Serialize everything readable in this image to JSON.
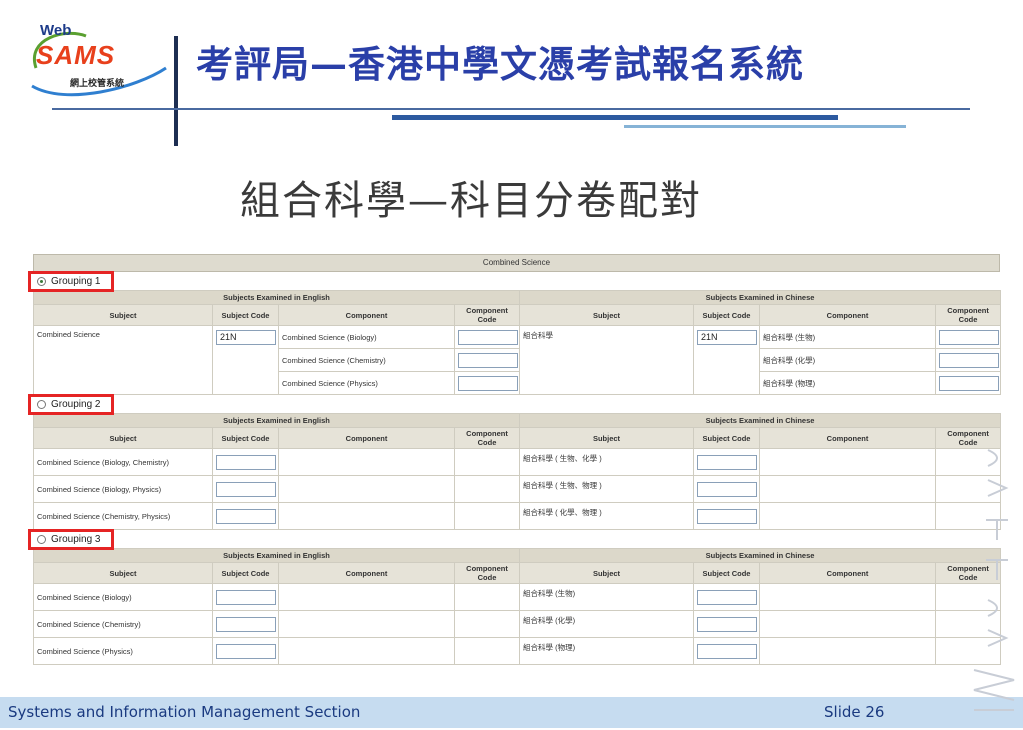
{
  "logo": {
    "line1": "Web",
    "line2": "SAMS",
    "line3": "網上校管系統"
  },
  "slide_title": "考評局—香港中學文憑考試報名系統",
  "subtitle": "組合科學—科目分卷配對",
  "screen": {
    "banner": "Combined Science",
    "english_header": "Subjects Examined in English",
    "chinese_header": "Subjects Examined in Chinese",
    "col_subject": "Subject",
    "col_subject_code": "Subject Code",
    "col_component": "Component",
    "col_component_code": "Component Code",
    "groupings": [
      {
        "label": "Grouping 1",
        "selected": true,
        "rows": [
          {
            "en_subject": "Combined Science",
            "en_code": "21N",
            "en_component": "Combined Science (Biology)",
            "zh_subject": "組合科學",
            "zh_code": "21N",
            "zh_component": "組合科學 (生物)"
          },
          {
            "en_subject": "",
            "en_code": "",
            "en_component": "Combined Science (Chemistry)",
            "zh_subject": "",
            "zh_code": "",
            "zh_component": "組合科學 (化學)"
          },
          {
            "en_subject": "",
            "en_code": "",
            "en_component": "Combined Science (Physics)",
            "zh_subject": "",
            "zh_code": "",
            "zh_component": "組合科學 (物理)"
          }
        ]
      },
      {
        "label": "Grouping 2",
        "selected": false,
        "rows": [
          {
            "en_subject": "Combined Science (Biology, Chemistry)",
            "zh_subject": "組合科學 ( 生物、化學 )"
          },
          {
            "en_subject": "Combined Science (Biology, Physics)",
            "zh_subject": "組合科學 ( 生物、物理 )"
          },
          {
            "en_subject": "Combined Science (Chemistry, Physics)",
            "zh_subject": "組合科學 ( 化學、物理 )"
          }
        ]
      },
      {
        "label": "Grouping 3",
        "selected": false,
        "rows": [
          {
            "en_subject": "Combined Science (Biology)",
            "zh_subject": "組合科學 (生物)"
          },
          {
            "en_subject": "Combined Science (Chemistry)",
            "zh_subject": "組合科學 (化學)"
          },
          {
            "en_subject": "Combined Science (Physics)",
            "zh_subject": "組合科學 (物理)"
          }
        ]
      }
    ]
  },
  "footer": {
    "org": "Systems and Information Management Section",
    "slide": "Slide 26"
  }
}
